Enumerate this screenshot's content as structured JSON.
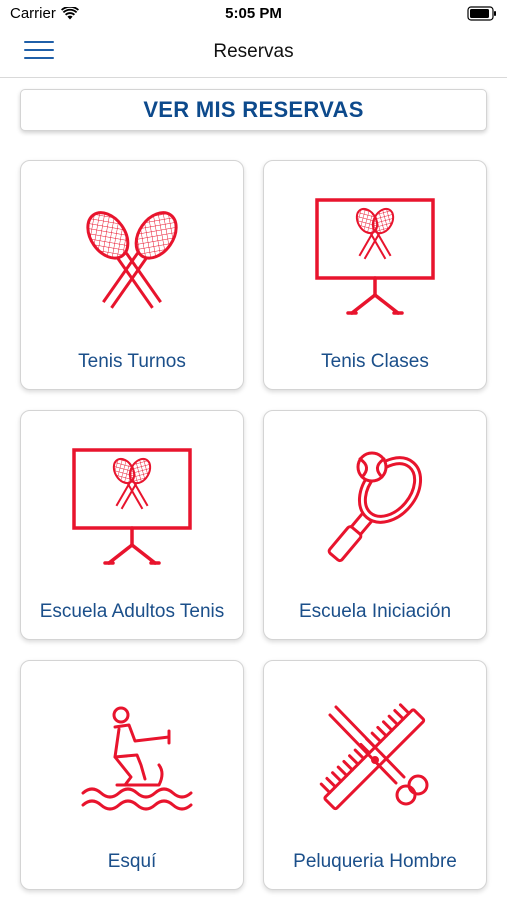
{
  "status": {
    "carrier": "Carrier",
    "time": "5:05 PM"
  },
  "nav": {
    "title": "Reservas"
  },
  "actions": {
    "ver_mis_reservas": "VER MIS RESERVAS"
  },
  "cards": [
    {
      "label": "Tenis Turnos",
      "icon": "tennis-rackets-icon"
    },
    {
      "label": "Tenis Clases",
      "icon": "tennis-class-board-icon"
    },
    {
      "label": "Escuela Adultos Tenis",
      "icon": "tennis-class-board-icon"
    },
    {
      "label": "Escuela Iniciación",
      "icon": "tennis-racket-ball-icon"
    },
    {
      "label": "Esquí",
      "icon": "water-ski-icon"
    },
    {
      "label": "Peluqueria Hombre",
      "icon": "scissors-comb-icon"
    }
  ],
  "colors": {
    "icon": "#e8142d",
    "text_blue": "#1b4f8a",
    "button_blue": "#0d4a8c",
    "menu_blue": "#1f5fa8"
  }
}
